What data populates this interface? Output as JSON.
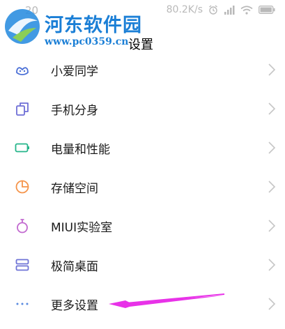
{
  "status_bar": {
    "time": "20",
    "network_speed": "80.2K/s"
  },
  "watermark": {
    "title": "河东软件园",
    "url": "www.pc0359.cn"
  },
  "header": {
    "title": "设置"
  },
  "settings": {
    "items": [
      {
        "label": "小爱同学",
        "icon": "xiaoai-icon",
        "icon_color": "#4a6fd6"
      },
      {
        "label": "手机分身",
        "icon": "clone-icon",
        "icon_color": "#6f6fd6"
      },
      {
        "label": "电量和性能",
        "icon": "battery-icon",
        "icon_color": "#25b58a"
      },
      {
        "label": "存储空间",
        "icon": "storage-pie-icon",
        "icon_color": "#f5944a"
      },
      {
        "label": "MIUI实验室",
        "icon": "lab-flask-icon",
        "icon_color": "#c26ad0"
      },
      {
        "label": "极简桌面",
        "icon": "simple-desktop-icon",
        "icon_color": "#6f74d6"
      },
      {
        "label": "更多设置",
        "icon": "more-dots-icon",
        "icon_color": "#5a8be0"
      }
    ]
  },
  "colors": {
    "annotation_arrow": "#e832e8",
    "watermark_blue": "#1b7fd6"
  }
}
